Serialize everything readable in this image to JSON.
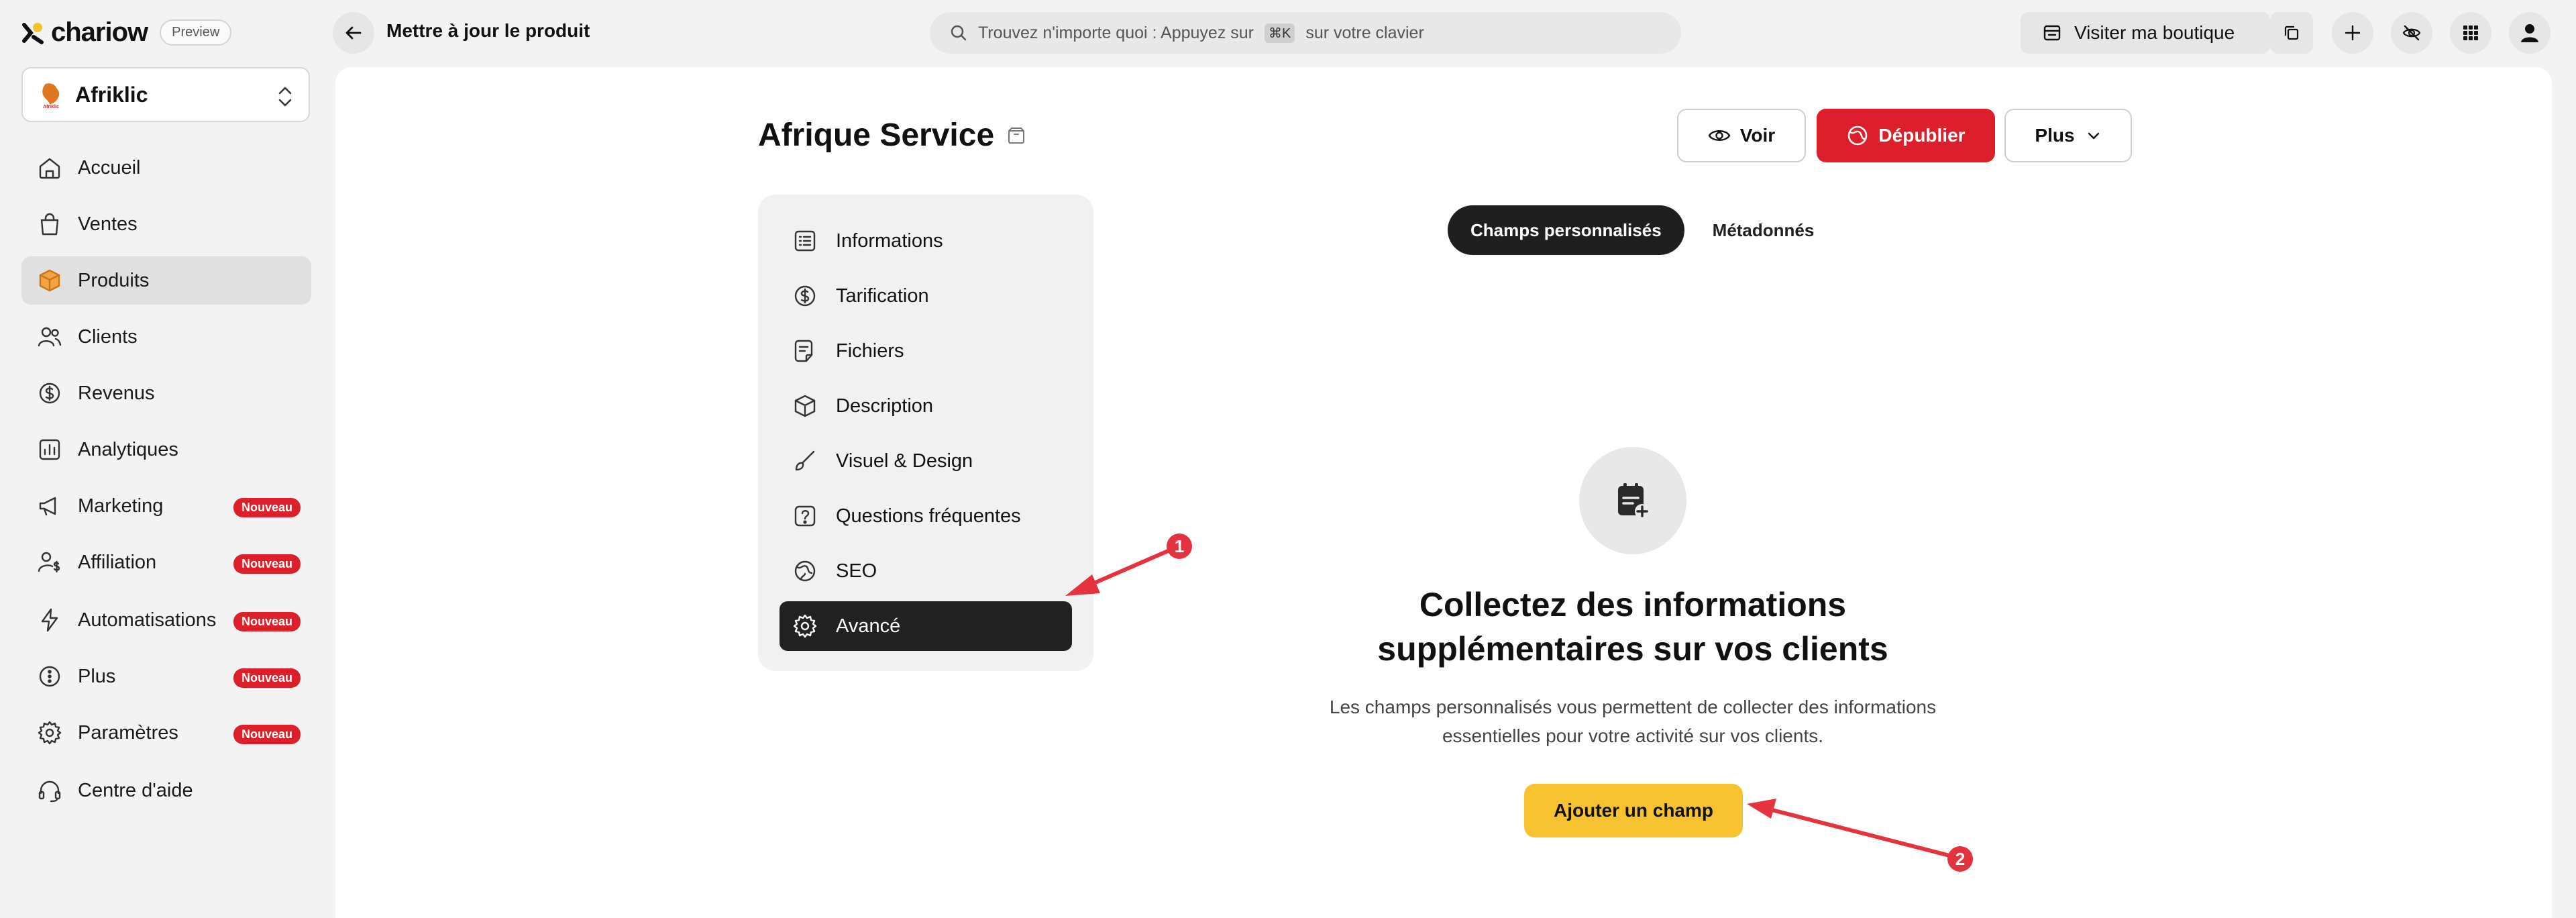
{
  "app": {
    "logo_text": "chariow",
    "preview_badge": "Preview",
    "page_heading": "Mettre à jour le produit"
  },
  "search": {
    "text_before": "Trouvez n'importe quoi : Appuyez sur",
    "shortcut": "⌘K",
    "text_after": "sur votre clavier"
  },
  "header": {
    "visit_label": "Visiter ma boutique"
  },
  "shop": {
    "name": "Afriklic",
    "logo_text": "Afriklic"
  },
  "sidebar": {
    "items": [
      {
        "label": "Accueil",
        "icon": "home-icon"
      },
      {
        "label": "Ventes",
        "icon": "shopping-bag-icon"
      },
      {
        "label": "Produits",
        "icon": "box-icon",
        "active": true
      },
      {
        "label": "Clients",
        "icon": "users-icon"
      },
      {
        "label": "Revenus",
        "icon": "dollar-circle-icon"
      },
      {
        "label": "Analytiques",
        "icon": "chart-icon"
      },
      {
        "label": "Marketing",
        "icon": "megaphone-icon",
        "badge": "Nouveau"
      },
      {
        "label": "Affiliation",
        "icon": "user-dollar-icon",
        "badge": "Nouveau"
      },
      {
        "label": "Automatisations",
        "icon": "bolt-icon",
        "badge": "Nouveau"
      },
      {
        "label": "Plus",
        "icon": "more-circle-icon",
        "badge": "Nouveau"
      },
      {
        "label": "Paramètres",
        "icon": "gear-icon",
        "badge": "Nouveau"
      },
      {
        "label": "Centre d'aide",
        "icon": "headset-icon"
      }
    ]
  },
  "product": {
    "title": "Afrique Service"
  },
  "actions": {
    "voir": "Voir",
    "depublier": "Dépublier",
    "plus": "Plus"
  },
  "menu": {
    "items": [
      {
        "label": "Informations",
        "icon": "list-icon"
      },
      {
        "label": "Tarification",
        "icon": "dollar-circle-icon"
      },
      {
        "label": "Fichiers",
        "icon": "file-icon"
      },
      {
        "label": "Description",
        "icon": "cube-icon"
      },
      {
        "label": "Visuel & Design",
        "icon": "brush-icon"
      },
      {
        "label": "Questions fréquentes",
        "icon": "question-icon"
      },
      {
        "label": "SEO",
        "icon": "globe-icon"
      },
      {
        "label": "Avancé",
        "icon": "gear-icon",
        "active": true
      }
    ]
  },
  "tabs": {
    "custom_fields": "Champs personnalisés",
    "metadata": "Métadonnés"
  },
  "empty_state": {
    "title_line1": "Collectez des informations",
    "title_line2": "supplémentaires sur vos clients",
    "desc_line1": "Les champs personnalisés vous permettent de collecter des informations",
    "desc_line2": "essentielles pour votre activité sur vos clients.",
    "button": "Ajouter un champ"
  },
  "annotations": {
    "marker_1": "1",
    "marker_2": "2",
    "color": "#e5323f"
  },
  "colors": {
    "danger": "#dc1f2b",
    "accent_yellow": "#f6c230",
    "active_dark": "#222222"
  }
}
